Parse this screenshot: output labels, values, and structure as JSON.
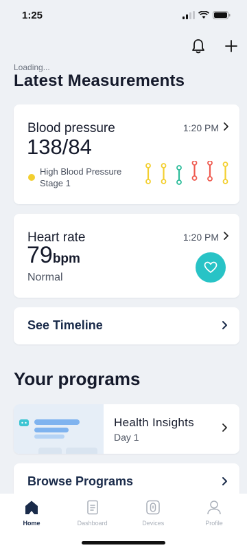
{
  "status_bar": {
    "time": "1:25"
  },
  "header": {
    "loading_text": "Loading...",
    "title": "Latest Measurements"
  },
  "blood_pressure": {
    "title": "Blood pressure",
    "time": "1:20 PM",
    "value": "138/84",
    "status": "High Blood Pressure Stage 1",
    "status_color": "#f3cf2f",
    "chart_colors": [
      "#f3cf2f",
      "#f3cf2f",
      "#2ebd9b",
      "#ef5a4f",
      "#ef5a4f",
      "#f3cf2f"
    ]
  },
  "heart_rate": {
    "title": "Heart rate",
    "time": "1:20 PM",
    "value": "79",
    "unit": "bpm",
    "status": "Normal",
    "badge_color": "#28c3c6",
    "badge_icon": "heart-icon"
  },
  "timeline": {
    "label": "See Timeline"
  },
  "programs": {
    "section_title": "Your programs",
    "items": [
      {
        "name": "Health Insights",
        "day": "Day 1"
      }
    ],
    "browse_label": "Browse Programs"
  },
  "tab_bar": {
    "tabs": [
      {
        "label": "Home",
        "icon": "home-icon",
        "active": true
      },
      {
        "label": "Dashboard",
        "icon": "dashboard-icon",
        "active": false
      },
      {
        "label": "Devices",
        "icon": "devices-icon",
        "active": false
      },
      {
        "label": "Profile",
        "icon": "profile-icon",
        "active": false
      }
    ]
  }
}
